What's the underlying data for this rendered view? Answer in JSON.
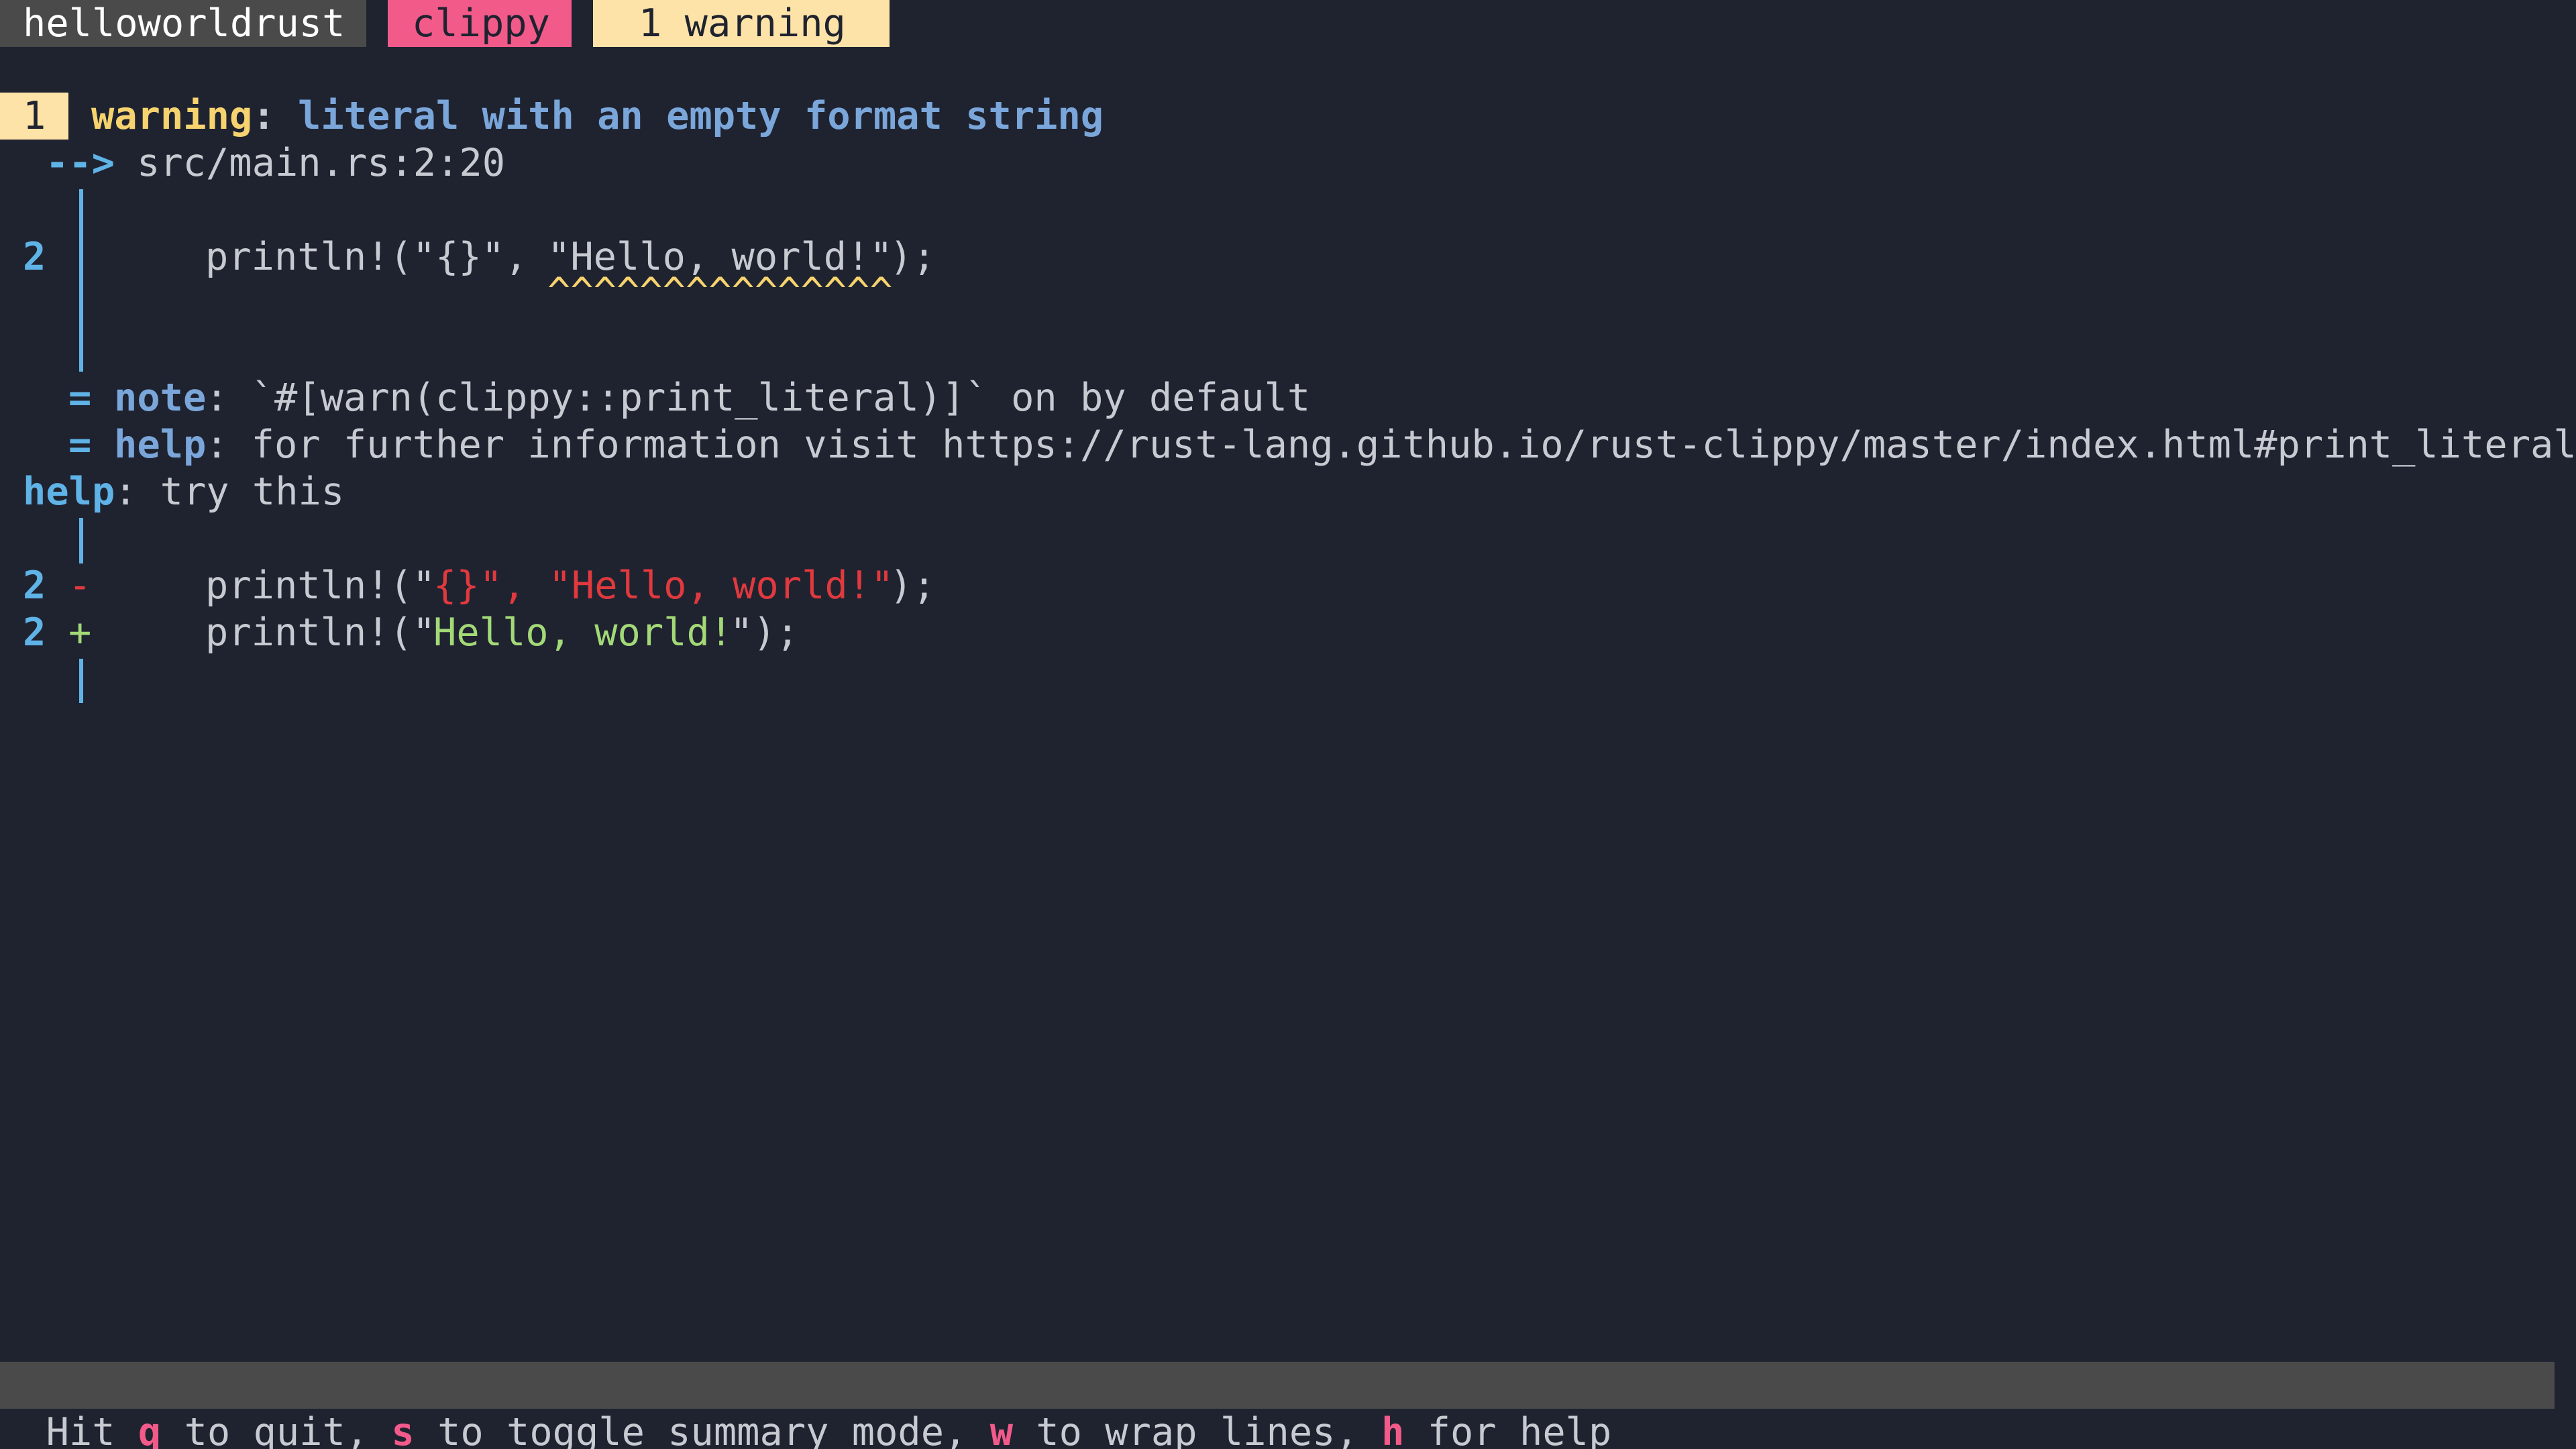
{
  "header": {
    "project": "helloworldrust",
    "tool": "clippy",
    "count": "1 warning"
  },
  "diagnostic": {
    "index": "1",
    "level": "warning",
    "colon": ":",
    "message": "literal with an empty format string",
    "arrow": "-->",
    "location": "src/main.rs:2:20",
    "line_number": "2",
    "code_a": "println!(\"{}\", ",
    "code_b": "\"Hello, world!\"",
    "code_c": ");",
    "carets": "^^^^^^^^^^^^^^^",
    "note_eq": "=",
    "note_label": "note",
    "note_text": ": `#[warn(clippy::print_literal)]` on by default",
    "help_eq": "=",
    "help_label": "help",
    "help_text": ": for further information visit https://rust-lang.github.io/rust-clippy/master/index.html#print_literal"
  },
  "suggestion": {
    "label": "help",
    "text": ": try this",
    "removed_line_no": "2",
    "removed_marker": "-",
    "removed_a": "println!(\"",
    "removed_b": "{}\", \"Hello, world!\"",
    "removed_c": ");",
    "added_line_no": "2",
    "added_marker": "+",
    "added_a": "println!(\"",
    "added_b": "Hello, world!",
    "added_c": "\");"
  },
  "statusbar": {
    "s1": "Hit ",
    "k1": "q",
    "s2": " to quit, ",
    "k2": "s",
    "s3": " to toggle summary mode, ",
    "k3": "w",
    "s4": " to wrap lines, ",
    "k4": "h",
    "s5": " for help"
  },
  "colors": {
    "background": "#1f2330",
    "text": "#c7cad1",
    "warning": "#f6d36f",
    "badge_yellow": "#fde3a7",
    "badge_pink": "#f25a8a",
    "badge_gray": "#4a4a4a",
    "blue": "#7aa6da",
    "cyan": "#5fb3e6",
    "removed": "#e0393e",
    "added": "#a3d977",
    "key": "#f25a8a"
  }
}
